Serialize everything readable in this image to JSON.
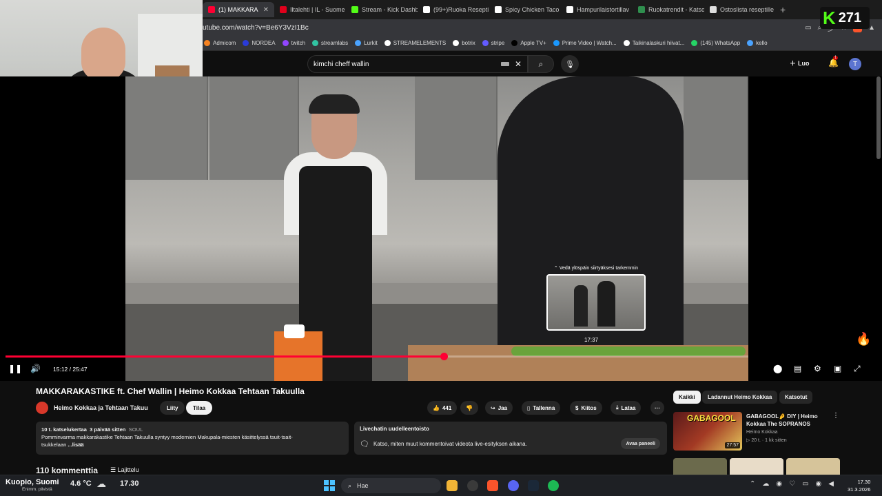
{
  "browser": {
    "tabs": [
      {
        "label": "(1) MAKKARA",
        "color": "#ff0033",
        "active": true
      },
      {
        "label": "Iltalehti | IL - Suome",
        "color": "#e0001b",
        "active": false
      },
      {
        "label": "Stream - Kick Dashb",
        "color": "#53fc18",
        "active": false
      },
      {
        "label": "(99+)Ruoka Resepti",
        "color": "#ffffff",
        "active": false
      },
      {
        "label": "Spicy Chicken Taco",
        "color": "#ffffff",
        "active": false
      },
      {
        "label": "Hampurilaistortillav",
        "color": "#ffffff",
        "active": false
      },
      {
        "label": "Ruokatrendit - Katso",
        "color": "#2f8f4e",
        "active": false
      },
      {
        "label": "Ostoslista reseptille",
        "color": "#dddddd",
        "active": false
      }
    ],
    "new_tab": "+",
    "url": "utube.com/watch?v=Be6Y3VzI1Bc",
    "bookmarks": [
      {
        "label": "Admicom",
        "color": "#f58220"
      },
      {
        "label": "NORDEA",
        "color": "#2a3bd8"
      },
      {
        "label": "twitch",
        "color": "#9146ff"
      },
      {
        "label": "streamlabs",
        "color": "#31c3a2"
      },
      {
        "label": "Lurkit",
        "color": "#4aa3ff"
      },
      {
        "label": "STREAMELEMENTS",
        "color": "#ffffff"
      },
      {
        "label": "botrix",
        "color": "#ffffff"
      },
      {
        "label": "stripe",
        "color": "#635bff"
      },
      {
        "label": "Apple TV+",
        "color": "#000000"
      },
      {
        "label": "Prime Video | Watch...",
        "color": "#1a98ff"
      },
      {
        "label": "Taikinalaskuri hiivat...",
        "color": "#ffffff"
      },
      {
        "label": "(145) WhatsApp",
        "color": "#25d366"
      },
      {
        "label": "kello",
        "color": "#4aa3ff"
      }
    ]
  },
  "kick_overlay": {
    "logo": "K",
    "viewers": "271"
  },
  "youtube": {
    "search": {
      "value": "kimchi cheff wallin"
    },
    "create_label": "Luo",
    "notif_count": "1",
    "avatar_letter": "T"
  },
  "player": {
    "current_time": "15:12",
    "duration": "25:47",
    "time_display": "15:12 / 25:47",
    "progress": 0.59,
    "hover_progress": 0.68,
    "hover_time": "17:37",
    "preview_hint": "⌃ Vedä ylöspäin siirtyäksesi tarkemmin",
    "accent": "#ff0033"
  },
  "video_meta": {
    "title": "MAKKARAKASTIKE ft. Chef Wallin | Heimo Kokkaa Tehtaan Takuulla",
    "channel": "Heimo Kokkaa ja Tehtaan Takuu",
    "join_label": "Liity",
    "subscribe_label": "Tilaa",
    "likes": "441",
    "share_label": "Jaa",
    "save_label": "Tallenna",
    "thanks_label": "Kiitos",
    "download_label": "Lataa",
    "more_label": "···"
  },
  "description": {
    "views": "10 t. katselukertaa",
    "date": "3 päivää sitten",
    "tag": "SOUL",
    "line1": "Pomminvarma makkarakastike Tehtaan Takuulla syntyy modernien Makupala-miesten käsittelyssä tsuit-tsait-",
    "line2": "tsukkelaan ",
    "more": "...lisää"
  },
  "livechat": {
    "header": "Livechatin uudelleentoisto",
    "body": "Katso, miten muut kommentoivat videota live-esityksen aikana.",
    "button": "Avaa paneeli"
  },
  "comments": {
    "count_label": "110 kommenttia",
    "sort_label": "Lajittelu"
  },
  "recommendations": {
    "chips": [
      {
        "label": "Kaikki",
        "active": true
      },
      {
        "label": "Ladannut Heimo Kokkaa",
        "active": false
      },
      {
        "label": "Katsotut",
        "active": false
      }
    ],
    "items": [
      {
        "title": "GABAGOOL🤌 DIY | Heimo Kokkaa The SOPRANOS",
        "channel": "Heimo Kokkaa",
        "meta": "▷ 20 t. · 1 kk sitten",
        "duration": "27:57",
        "thumb_text": "GABAGOOL"
      }
    ]
  },
  "taskbar": {
    "location": "Kuopio, Suomi",
    "location_sub": "Enimm. pilvistä",
    "temperature": "4.6 °C",
    "bar_time": "17.30",
    "search_placeholder": "Hae",
    "clock_time": "17.30",
    "clock_date": "31.3.2026"
  }
}
